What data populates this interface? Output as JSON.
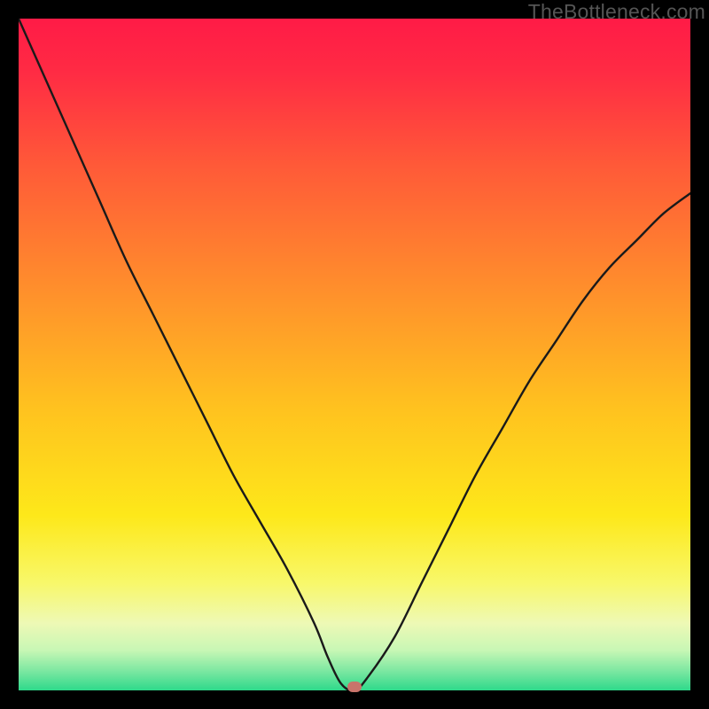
{
  "watermark": "TheBottleneck.com",
  "colors": {
    "black": "#000000",
    "marker": "#c9746b",
    "curve": "#1a1a1a",
    "gradient_stops": [
      {
        "offset": 0.0,
        "color": "#ff1b46"
      },
      {
        "offset": 0.08,
        "color": "#ff2b44"
      },
      {
        "offset": 0.22,
        "color": "#ff5a38"
      },
      {
        "offset": 0.4,
        "color": "#ff8e2c"
      },
      {
        "offset": 0.58,
        "color": "#ffc21f"
      },
      {
        "offset": 0.74,
        "color": "#fde81a"
      },
      {
        "offset": 0.84,
        "color": "#f8f86a"
      },
      {
        "offset": 0.9,
        "color": "#eef9b5"
      },
      {
        "offset": 0.94,
        "color": "#c8f7b5"
      },
      {
        "offset": 0.97,
        "color": "#7fe8a2"
      },
      {
        "offset": 1.0,
        "color": "#2ed98b"
      }
    ]
  },
  "chart_data": {
    "type": "line",
    "title": "",
    "xlabel": "",
    "ylabel": "",
    "xlim": [
      0,
      100
    ],
    "ylim": [
      0,
      100
    ],
    "x": [
      0,
      4,
      8,
      12,
      16,
      20,
      24,
      28,
      32,
      36,
      40,
      44,
      46,
      48,
      50,
      52,
      56,
      60,
      64,
      68,
      72,
      76,
      80,
      84,
      88,
      92,
      96,
      100
    ],
    "values": [
      100,
      91,
      82,
      73,
      64,
      56,
      48,
      40,
      32,
      25,
      18,
      10,
      5,
      1,
      0,
      2,
      8,
      16,
      24,
      32,
      39,
      46,
      52,
      58,
      63,
      67,
      71,
      74
    ],
    "marker": {
      "x": 50,
      "y": 0.5
    }
  }
}
